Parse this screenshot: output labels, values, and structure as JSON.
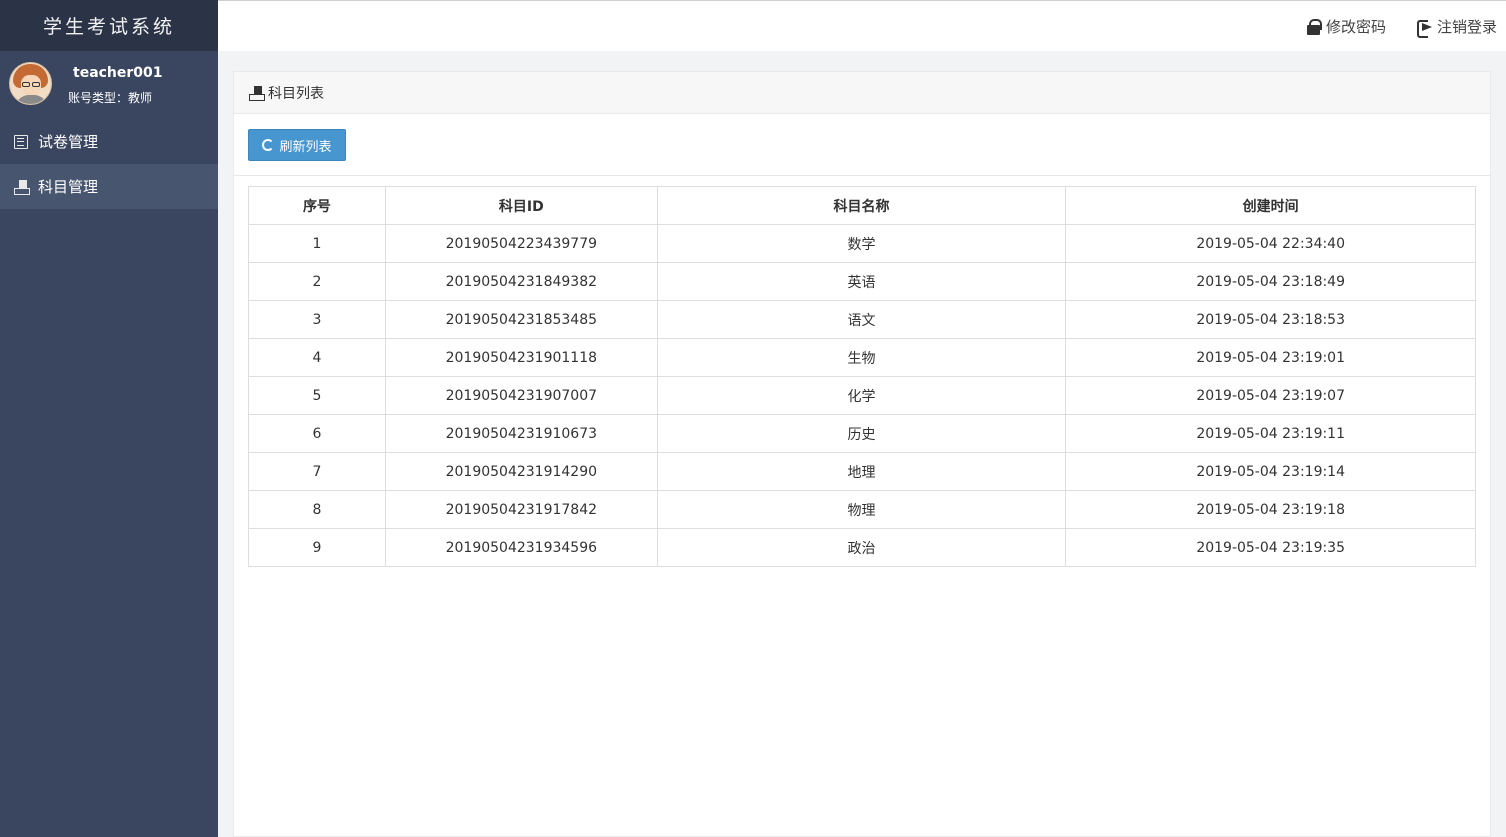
{
  "app": {
    "title": "学生考试系统"
  },
  "user": {
    "name": "teacher001",
    "type_label": "账号类型：教师"
  },
  "sidebar": {
    "items": [
      {
        "label": "试卷管理",
        "icon": "list-icon",
        "active": false
      },
      {
        "label": "科目管理",
        "icon": "subject-icon",
        "active": true
      }
    ]
  },
  "topbar": {
    "change_password": "修改密码",
    "logout": "注销登录"
  },
  "panel": {
    "title": "科目列表",
    "refresh_label": "刷新列表"
  },
  "table": {
    "headers": [
      "序号",
      "科目ID",
      "科目名称",
      "创建时间"
    ],
    "rows": [
      [
        "1",
        "20190504223439779",
        "数学",
        "2019-05-04 22:34:40"
      ],
      [
        "2",
        "20190504231849382",
        "英语",
        "2019-05-04 23:18:49"
      ],
      [
        "3",
        "20190504231853485",
        "语文",
        "2019-05-04 23:18:53"
      ],
      [
        "4",
        "20190504231901118",
        "生物",
        "2019-05-04 23:19:01"
      ],
      [
        "5",
        "20190504231907007",
        "化学",
        "2019-05-04 23:19:07"
      ],
      [
        "6",
        "20190504231910673",
        "历史",
        "2019-05-04 23:19:11"
      ],
      [
        "7",
        "20190504231914290",
        "地理",
        "2019-05-04 23:19:14"
      ],
      [
        "8",
        "20190504231917842",
        "物理",
        "2019-05-04 23:19:18"
      ],
      [
        "9",
        "20190504231934596",
        "政治",
        "2019-05-04 23:19:35"
      ]
    ]
  },
  "colors": {
    "sidebar": "#3a4660",
    "brand": "#2b3447",
    "active": "#48556e",
    "button": "#4796d0"
  }
}
